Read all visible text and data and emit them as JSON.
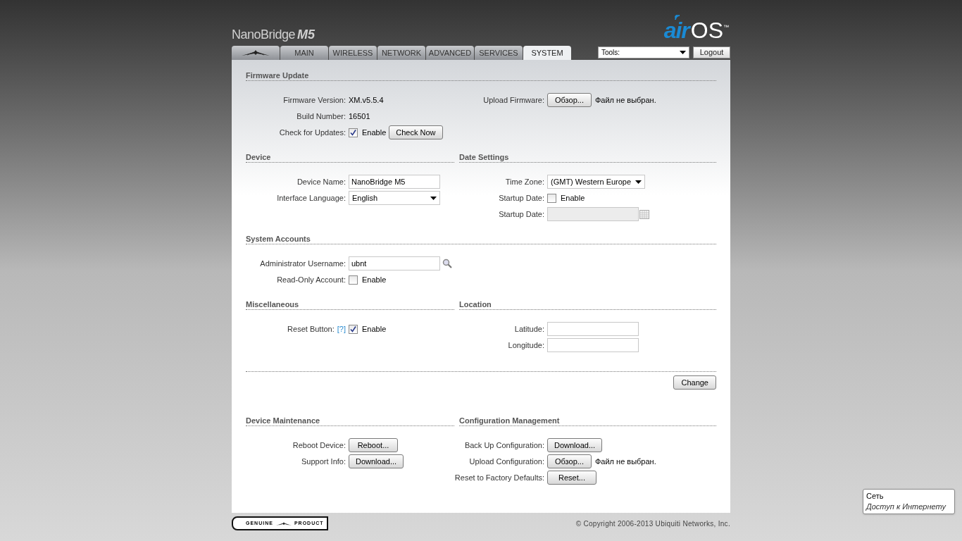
{
  "header": {
    "product": "NanoBridge",
    "model": "M5",
    "logo_air": "air",
    "logo_os": "OS",
    "logo_tm": "™"
  },
  "tabs": [
    {
      "kind": "logo",
      "selected": false
    },
    {
      "kind": "text",
      "label": "MAIN",
      "selected": false
    },
    {
      "kind": "text",
      "label": "WIRELESS",
      "selected": false
    },
    {
      "kind": "text",
      "label": "NETWORK",
      "selected": false
    },
    {
      "kind": "text",
      "label": "ADVANCED",
      "selected": false
    },
    {
      "kind": "text",
      "label": "SERVICES",
      "selected": false
    },
    {
      "kind": "text",
      "label": "SYSTEM",
      "selected": true
    }
  ],
  "tools": {
    "value": "Tools:"
  },
  "logout": "Logout",
  "upper_rows": [
    [
      {
        "title": "Firmware Update",
        "columns": [
          [
            {
              "kind": "text",
              "label": "Firmware Version:",
              "value": "XM.v5.5.4"
            },
            {
              "kind": "text",
              "label": "Build Number:",
              "value": "16501"
            },
            {
              "kind": "checkbox",
              "label": "Check for Updates:",
              "checked": true,
              "text": "Enable",
              "button": "Check Now"
            }
          ],
          [
            {
              "kind": "file",
              "label": "Upload Firmware:",
              "button": "Обзор...",
              "status": "Файл не выбран."
            }
          ]
        ]
      }
    ],
    [
      {
        "title": "Device",
        "columns": [
          [
            {
              "kind": "input",
              "label": "Device Name:",
              "value": "NanoBridge M5"
            },
            {
              "kind": "select",
              "label": "Interface Language:",
              "value": "English"
            }
          ]
        ]
      },
      {
        "title": "Date Settings",
        "columns": [
          [
            {
              "kind": "select",
              "label": "Time Zone:",
              "value": "(GMT) Western Europe",
              "compact": true
            },
            {
              "kind": "checkbox",
              "label": "Startup Date:",
              "checked": false,
              "text": "Enable"
            },
            {
              "kind": "date",
              "label": "Startup Date:"
            }
          ]
        ]
      }
    ],
    [
      {
        "title": "System Accounts",
        "columns": [
          [
            {
              "kind": "input",
              "label": "Administrator Username:",
              "value": "ubnt",
              "search": true
            },
            {
              "kind": "checkbox",
              "label": "Read-Only Account:",
              "checked": false,
              "text": "Enable"
            }
          ]
        ]
      }
    ],
    [
      {
        "title": "Miscellaneous",
        "columns": [
          [
            {
              "kind": "checkbox",
              "label": "Reset Button:",
              "help": "[?]",
              "checked": true,
              "text": "Enable"
            }
          ]
        ]
      },
      {
        "title": "Location",
        "columns": [
          [
            {
              "kind": "input",
              "label": "Latitude:"
            },
            {
              "kind": "input",
              "label": "Longitude:"
            }
          ]
        ]
      }
    ]
  ],
  "change_button": "Change",
  "lower_rows": [
    [
      {
        "title": "Device Maintenance",
        "columns": [
          [
            {
              "kind": "button",
              "label": "Reboot Device:",
              "button": "Reboot..."
            },
            {
              "kind": "button",
              "label": "Support Info:",
              "button": "Download..."
            }
          ]
        ]
      },
      {
        "title": "Configuration Management",
        "columns": [
          [
            {
              "kind": "button",
              "label": "Back Up Configuration:",
              "button": "Download..."
            },
            {
              "kind": "file",
              "label": "Upload Configuration:",
              "button": "Обзор...",
              "status": "Файл не выбран."
            },
            {
              "kind": "button",
              "label": "Reset to Factory Defaults:",
              "button": "Reset..."
            }
          ]
        ]
      }
    ]
  ],
  "footer": {
    "badge_left": "GENUINE",
    "badge_right": "PRODUCT",
    "copyright": "© Copyright 2006-2013 Ubiquiti Networks, Inc."
  },
  "network_tooltip": {
    "title": "Сеть",
    "status": "Доступ к Интернету"
  }
}
